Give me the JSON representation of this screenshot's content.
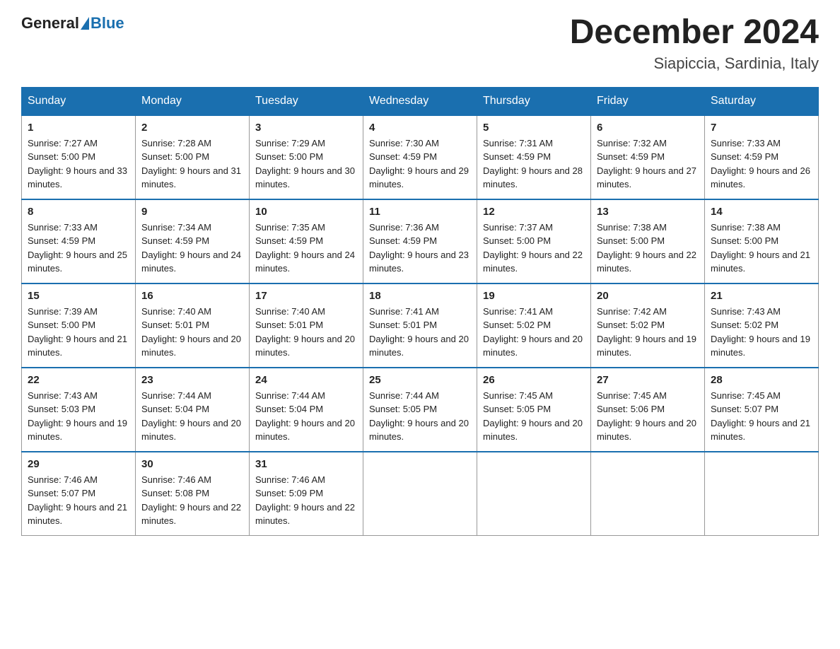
{
  "header": {
    "logo_general": "General",
    "logo_blue": "Blue",
    "month_title": "December 2024",
    "location": "Siapiccia, Sardinia, Italy"
  },
  "days_of_week": [
    "Sunday",
    "Monday",
    "Tuesday",
    "Wednesday",
    "Thursday",
    "Friday",
    "Saturday"
  ],
  "weeks": [
    [
      {
        "day": "1",
        "sunrise": "7:27 AM",
        "sunset": "5:00 PM",
        "daylight": "9 hours and 33 minutes."
      },
      {
        "day": "2",
        "sunrise": "7:28 AM",
        "sunset": "5:00 PM",
        "daylight": "9 hours and 31 minutes."
      },
      {
        "day": "3",
        "sunrise": "7:29 AM",
        "sunset": "5:00 PM",
        "daylight": "9 hours and 30 minutes."
      },
      {
        "day": "4",
        "sunrise": "7:30 AM",
        "sunset": "4:59 PM",
        "daylight": "9 hours and 29 minutes."
      },
      {
        "day": "5",
        "sunrise": "7:31 AM",
        "sunset": "4:59 PM",
        "daylight": "9 hours and 28 minutes."
      },
      {
        "day": "6",
        "sunrise": "7:32 AM",
        "sunset": "4:59 PM",
        "daylight": "9 hours and 27 minutes."
      },
      {
        "day": "7",
        "sunrise": "7:33 AM",
        "sunset": "4:59 PM",
        "daylight": "9 hours and 26 minutes."
      }
    ],
    [
      {
        "day": "8",
        "sunrise": "7:33 AM",
        "sunset": "4:59 PM",
        "daylight": "9 hours and 25 minutes."
      },
      {
        "day": "9",
        "sunrise": "7:34 AM",
        "sunset": "4:59 PM",
        "daylight": "9 hours and 24 minutes."
      },
      {
        "day": "10",
        "sunrise": "7:35 AM",
        "sunset": "4:59 PM",
        "daylight": "9 hours and 24 minutes."
      },
      {
        "day": "11",
        "sunrise": "7:36 AM",
        "sunset": "4:59 PM",
        "daylight": "9 hours and 23 minutes."
      },
      {
        "day": "12",
        "sunrise": "7:37 AM",
        "sunset": "5:00 PM",
        "daylight": "9 hours and 22 minutes."
      },
      {
        "day": "13",
        "sunrise": "7:38 AM",
        "sunset": "5:00 PM",
        "daylight": "9 hours and 22 minutes."
      },
      {
        "day": "14",
        "sunrise": "7:38 AM",
        "sunset": "5:00 PM",
        "daylight": "9 hours and 21 minutes."
      }
    ],
    [
      {
        "day": "15",
        "sunrise": "7:39 AM",
        "sunset": "5:00 PM",
        "daylight": "9 hours and 21 minutes."
      },
      {
        "day": "16",
        "sunrise": "7:40 AM",
        "sunset": "5:01 PM",
        "daylight": "9 hours and 20 minutes."
      },
      {
        "day": "17",
        "sunrise": "7:40 AM",
        "sunset": "5:01 PM",
        "daylight": "9 hours and 20 minutes."
      },
      {
        "day": "18",
        "sunrise": "7:41 AM",
        "sunset": "5:01 PM",
        "daylight": "9 hours and 20 minutes."
      },
      {
        "day": "19",
        "sunrise": "7:41 AM",
        "sunset": "5:02 PM",
        "daylight": "9 hours and 20 minutes."
      },
      {
        "day": "20",
        "sunrise": "7:42 AM",
        "sunset": "5:02 PM",
        "daylight": "9 hours and 19 minutes."
      },
      {
        "day": "21",
        "sunrise": "7:43 AM",
        "sunset": "5:02 PM",
        "daylight": "9 hours and 19 minutes."
      }
    ],
    [
      {
        "day": "22",
        "sunrise": "7:43 AM",
        "sunset": "5:03 PM",
        "daylight": "9 hours and 19 minutes."
      },
      {
        "day": "23",
        "sunrise": "7:44 AM",
        "sunset": "5:04 PM",
        "daylight": "9 hours and 20 minutes."
      },
      {
        "day": "24",
        "sunrise": "7:44 AM",
        "sunset": "5:04 PM",
        "daylight": "9 hours and 20 minutes."
      },
      {
        "day": "25",
        "sunrise": "7:44 AM",
        "sunset": "5:05 PM",
        "daylight": "9 hours and 20 minutes."
      },
      {
        "day": "26",
        "sunrise": "7:45 AM",
        "sunset": "5:05 PM",
        "daylight": "9 hours and 20 minutes."
      },
      {
        "day": "27",
        "sunrise": "7:45 AM",
        "sunset": "5:06 PM",
        "daylight": "9 hours and 20 minutes."
      },
      {
        "day": "28",
        "sunrise": "7:45 AM",
        "sunset": "5:07 PM",
        "daylight": "9 hours and 21 minutes."
      }
    ],
    [
      {
        "day": "29",
        "sunrise": "7:46 AM",
        "sunset": "5:07 PM",
        "daylight": "9 hours and 21 minutes."
      },
      {
        "day": "30",
        "sunrise": "7:46 AM",
        "sunset": "5:08 PM",
        "daylight": "9 hours and 22 minutes."
      },
      {
        "day": "31",
        "sunrise": "7:46 AM",
        "sunset": "5:09 PM",
        "daylight": "9 hours and 22 minutes."
      },
      null,
      null,
      null,
      null
    ]
  ]
}
